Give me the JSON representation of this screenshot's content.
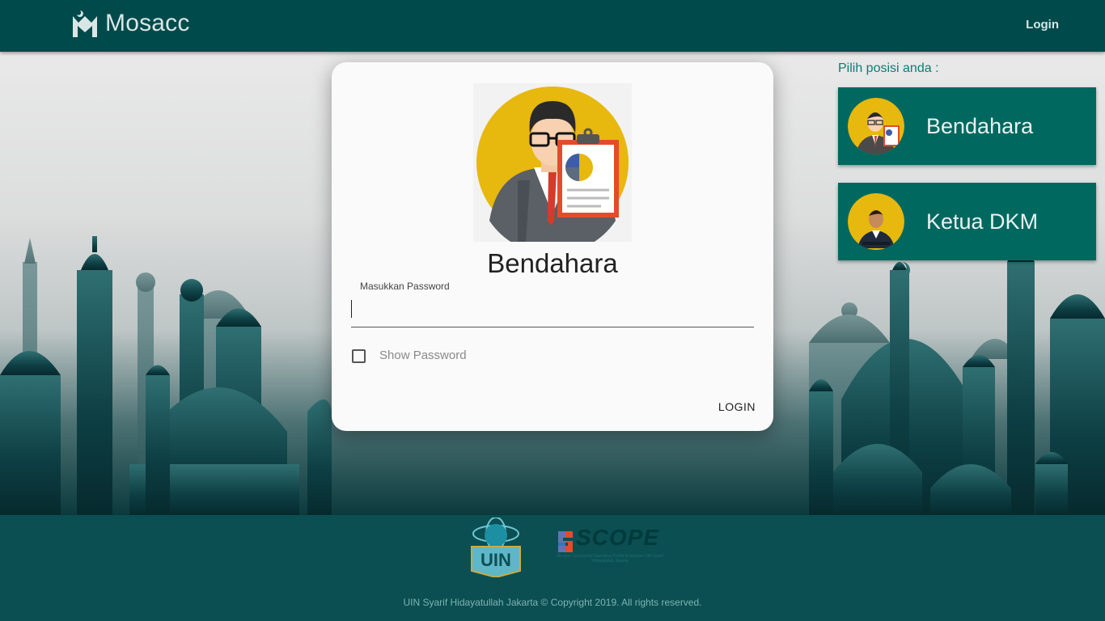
{
  "header": {
    "brand": "Mosacc",
    "login_link": "Login"
  },
  "side": {
    "title": "Pilih posisi anda :",
    "roles": [
      {
        "label": "Bendahara"
      },
      {
        "label": "Ketua DKM"
      }
    ]
  },
  "modal": {
    "title": "Bendahara",
    "password_label": "Masukkan Password",
    "password_value": "",
    "show_password_label": "Show Password",
    "login_button": "LOGIN"
  },
  "footer": {
    "logo_uin": "UIN",
    "logo_scope": "SCOPE",
    "scope_subtitle": "Mosque Community Operating Profile Enterprise UIN Syarif Hidayatullah Jakarta",
    "copyright": "UIN Syarif Hidayatullah Jakarta © Copyright 2019. All rights reserved."
  },
  "colors": {
    "primary": "#014a4b",
    "accent": "#00685f",
    "footer": "#0b4f52"
  }
}
